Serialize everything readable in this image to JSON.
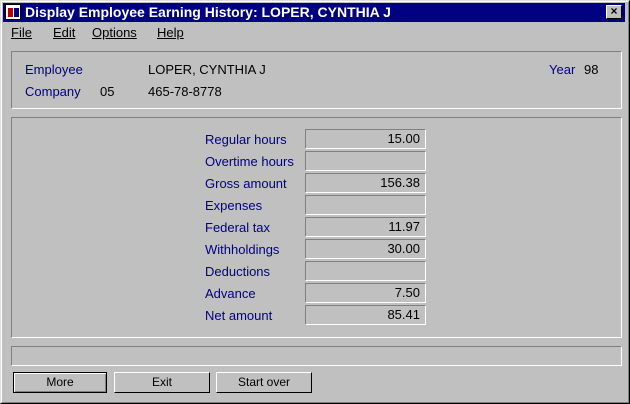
{
  "window": {
    "title": "Display Employee Earning History:  LOPER, CYNTHIA J",
    "close_glyph": "×"
  },
  "menu": [
    {
      "label": "File"
    },
    {
      "label": "Edit"
    },
    {
      "label": "Options"
    },
    {
      "label": "Help"
    }
  ],
  "header": {
    "employee_label": "Employee",
    "employee_name": "LOPER, CYNTHIA J",
    "year_label": "Year",
    "year_value": "98",
    "company_label": "Company",
    "company_code": "05",
    "ssn": "465-78-8778"
  },
  "earnings": [
    {
      "label": "Regular hours",
      "value": "15.00"
    },
    {
      "label": "Overtime hours",
      "value": ""
    },
    {
      "label": "Gross amount",
      "value": "156.38"
    },
    {
      "label": "Expenses",
      "value": ""
    },
    {
      "label": "Federal tax",
      "value": "11.97"
    },
    {
      "label": "Withholdings",
      "value": "30.00"
    },
    {
      "label": "Deductions",
      "value": ""
    },
    {
      "label": "Advance",
      "value": "7.50"
    },
    {
      "label": "Net amount",
      "value": "85.41"
    }
  ],
  "status": {
    "message": ""
  },
  "buttons": {
    "more": "More",
    "exit": "Exit",
    "start_over": "Start over"
  },
  "colors": {
    "titlebar": "#000080",
    "label_text": "#000080",
    "face": "#c0c0c0"
  }
}
